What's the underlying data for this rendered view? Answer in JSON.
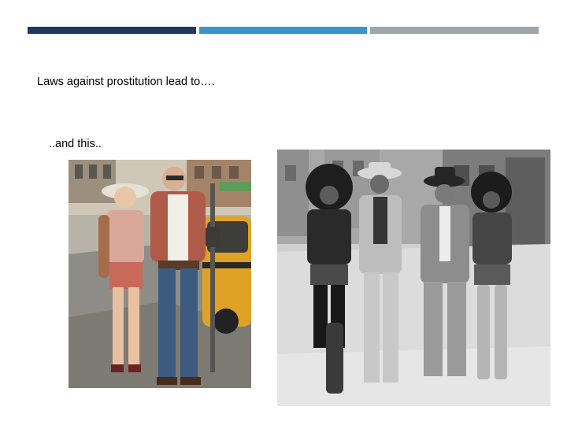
{
  "slide": {
    "heading": "Laws against prostitution lead to….",
    "subtext": "..and this..",
    "accent_bars": [
      {
        "color": "#1f3864"
      },
      {
        "color": "#3a96c8"
      },
      {
        "color": "#9ea5ac"
      }
    ]
  },
  "images": {
    "left_photo": {
      "description": "color street photograph of a couple walking past a yellow taxi"
    },
    "right_photo": {
      "description": "black and white street photograph of four people walking arm in arm"
    }
  }
}
